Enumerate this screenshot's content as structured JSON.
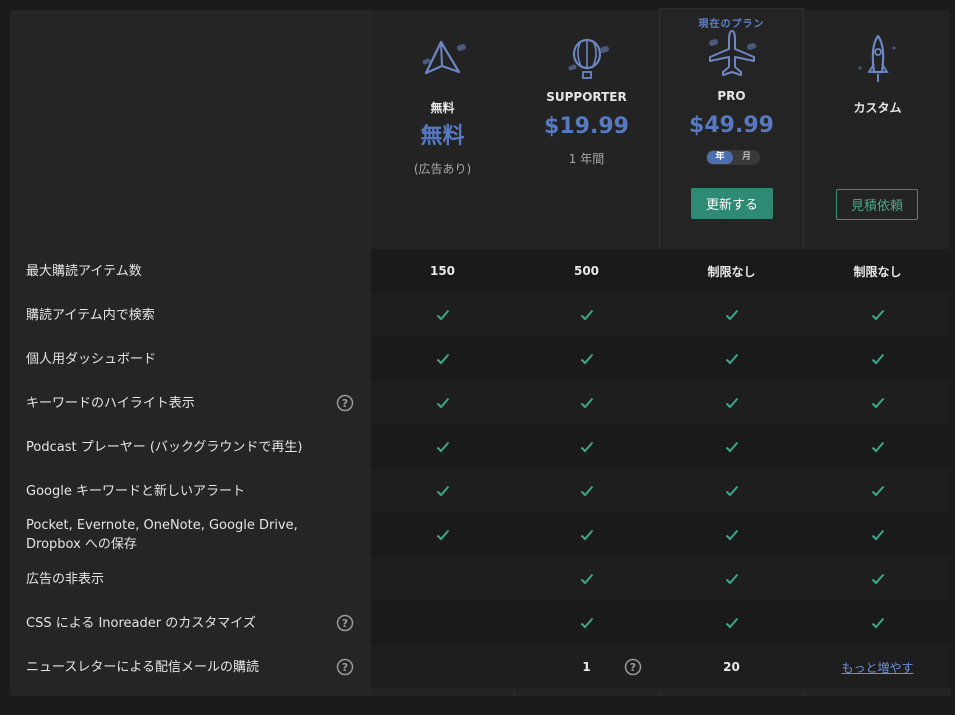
{
  "plans": [
    {
      "name": "無料",
      "price": "無料",
      "sub": "(広告あり)"
    },
    {
      "name": "SUPPORTER",
      "price": "$19.99",
      "sub": "1 年間"
    },
    {
      "name": "PRO",
      "price": "$49.99",
      "current_label": "現在のプラン",
      "toggle_year": "年",
      "toggle_month": "月",
      "button": "更新する"
    },
    {
      "name": "カスタム",
      "button": "見積依頼"
    }
  ],
  "features": [
    {
      "label": "最大購読アイテム数",
      "help": false,
      "values": [
        "150",
        "500",
        "制限なし",
        "制限なし"
      ]
    },
    {
      "label": "購読アイテム内で検索",
      "help": false,
      "values": [
        "check",
        "check",
        "check",
        "check"
      ]
    },
    {
      "label": "個人用ダッシュボード",
      "help": false,
      "values": [
        "check",
        "check",
        "check",
        "check"
      ]
    },
    {
      "label": "キーワードのハイライト表示",
      "help": true,
      "values": [
        "check",
        "check",
        "check",
        "check"
      ]
    },
    {
      "label": "Podcast プレーヤー (バックグラウンドで再生)",
      "help": false,
      "values": [
        "check",
        "check",
        "check",
        "check"
      ]
    },
    {
      "label": "Google キーワードと新しいアラート",
      "help": false,
      "values": [
        "check",
        "check",
        "check",
        "check"
      ]
    },
    {
      "label": "Pocket, Evernote, OneNote, Google Drive, Dropbox への保存",
      "help": false,
      "values": [
        "check",
        "check",
        "check",
        "check"
      ]
    },
    {
      "label": "広告の非表示",
      "help": false,
      "values": [
        "",
        "check",
        "check",
        "check"
      ]
    },
    {
      "label": "CSS による Inoreader のカスタマイズ",
      "help": true,
      "values": [
        "",
        "check",
        "check",
        "check"
      ]
    },
    {
      "label": "ニュースレターによる配信メールの購読",
      "help": true,
      "values": [
        "",
        "1",
        "20",
        "link"
      ],
      "link_text": "もっと増やす"
    }
  ],
  "colors": {
    "accent_green": "#2f8a73",
    "price_blue": "#5679c0",
    "check_green": "#3aa88a"
  }
}
